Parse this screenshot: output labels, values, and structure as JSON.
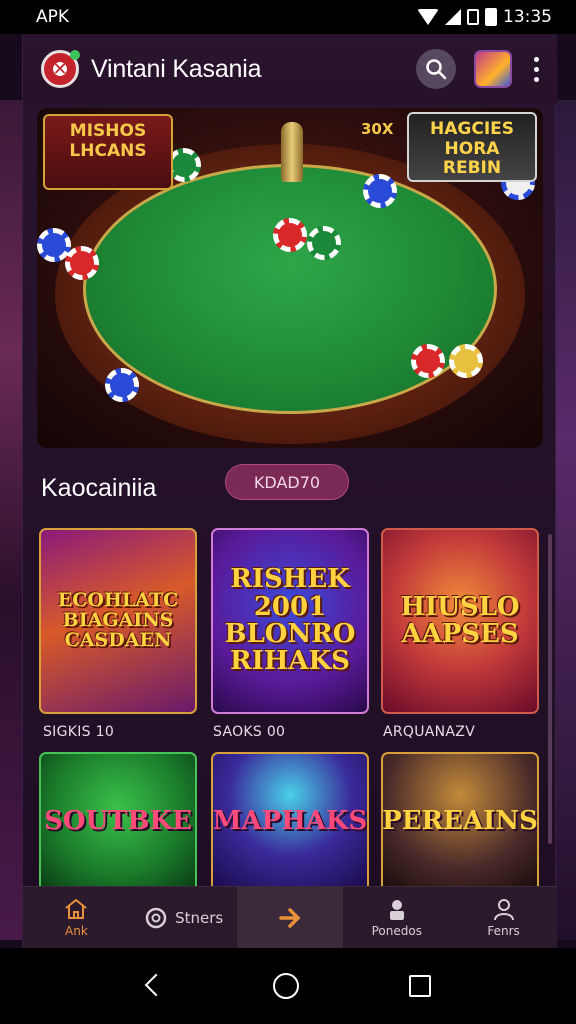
{
  "status_bar": {
    "carrier": "APK",
    "time": "13:35"
  },
  "header": {
    "title": "Vintani Kasania"
  },
  "hero": {
    "promo_left": "MISHOS LHCANS",
    "promo_center": "30X",
    "promo_right": "HAGCIES HORA REBIN"
  },
  "section": {
    "title": "Kaocainiia",
    "pill": "KDAD70"
  },
  "games": [
    {
      "art": "ECOHLATC BIAGAINS CASDAEN",
      "caption": "SIGKIS 10"
    },
    {
      "art": "RISHEK 2001 BLONRO RIHAKS",
      "caption": "SAOKS 00"
    },
    {
      "art": "HIUSLO AAPSES",
      "caption": "ARQUANAZV"
    },
    {
      "art": "SOUTBKE",
      "caption": ""
    },
    {
      "art": "MAPHAKS",
      "caption": ""
    },
    {
      "art": "PEREAINS",
      "caption": ""
    }
  ],
  "bottom_nav": {
    "home": "Ank",
    "bets": "Stners",
    "recent": "Ponedos",
    "profile": "Fenrs"
  },
  "colors": {
    "accent": "#e8903a",
    "pill": "#7a2a55",
    "background": "#24112a"
  }
}
